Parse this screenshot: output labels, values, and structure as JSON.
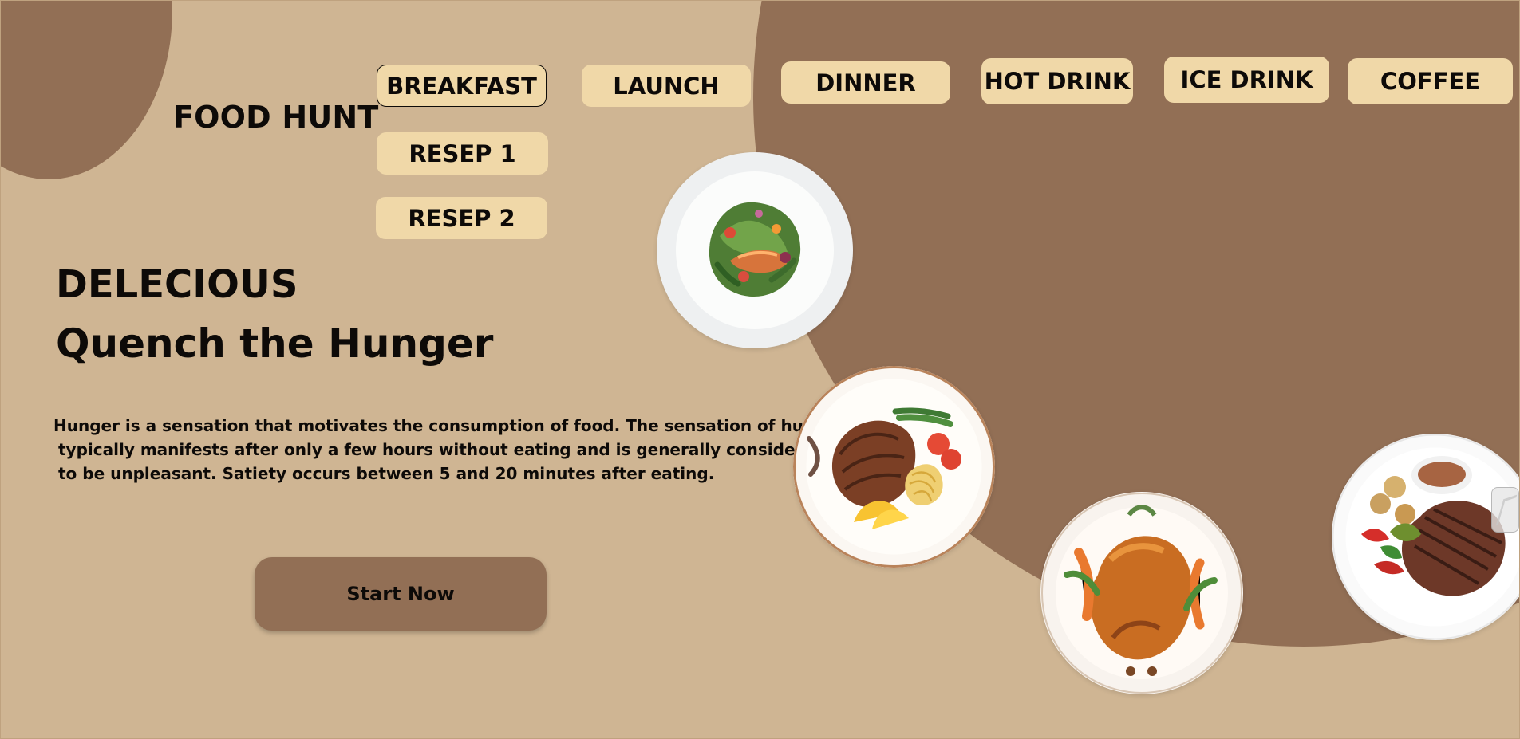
{
  "brand": {
    "name": "FOOD HUNT"
  },
  "nav": {
    "items": [
      {
        "label": "BREAKFAST",
        "active": true
      },
      {
        "label": "LAUNCH",
        "active": false
      },
      {
        "label": "DINNER",
        "active": false
      },
      {
        "label": "HOT DRINK",
        "active": false
      },
      {
        "label": "ICE DRINK",
        "active": false
      },
      {
        "label": "COFFEE",
        "active": false
      }
    ],
    "submenu": [
      {
        "label": "RESEP 1"
      },
      {
        "label": "RESEP 2"
      }
    ]
  },
  "hero": {
    "kicker": "DELECIOUS",
    "title": "Quench the Hunger",
    "description_lines": [
      "Hunger is a sensation that motivates the consumption of food. The sensation of hunger",
      "typically manifests after only a few hours without eating and is generally considered",
      "to be unpleasant. Satiety occurs between 5 and 20 minutes after eating."
    ],
    "cta_label": "Start Now"
  },
  "icons": {
    "salad_plate": "salmon-salad-icon",
    "steak_plate": "steak-pasta-plate-icon",
    "roast_plate": "roast-chicken-icon",
    "grill_plate": "grilled-steak-icon",
    "scroll": "scroll-handle-icon"
  },
  "theme": {
    "background": "#cfb593",
    "blob": "#926f55",
    "pill": "#f0d8a8",
    "text": "#0d0a08"
  }
}
